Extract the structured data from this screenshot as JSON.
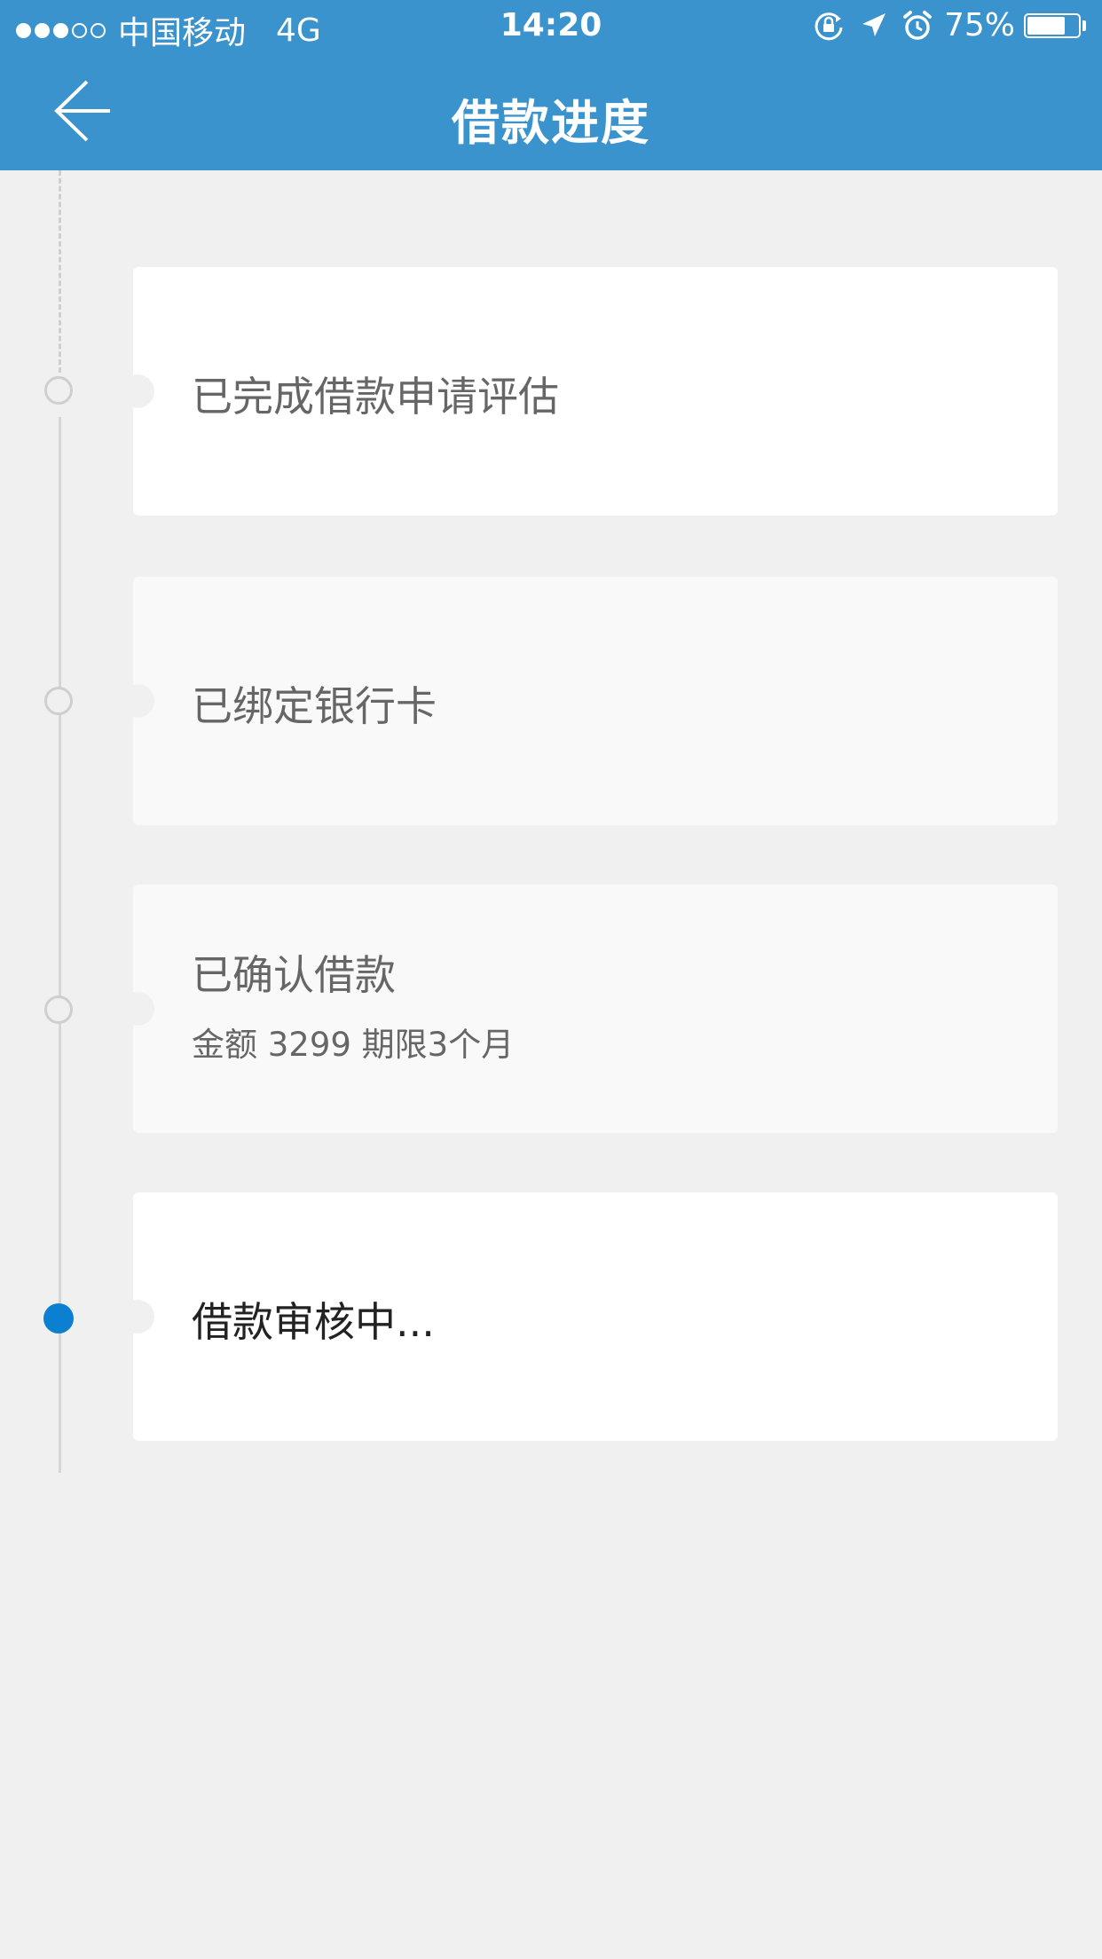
{
  "status_bar": {
    "signal_dots": [
      "on",
      "on",
      "on",
      "off",
      "off"
    ],
    "carrier": "中国移动",
    "network": "4G",
    "time": "14:20",
    "battery_percent": "75%",
    "battery_level": 0.75,
    "icons": [
      "rotation-lock-icon",
      "location-arrow-icon",
      "alarm-icon",
      "battery-icon"
    ]
  },
  "header": {
    "title": "借款进度",
    "back_icon": "arrow-left-icon"
  },
  "colors": {
    "header_bg": "#3a93cc",
    "active_node": "#0b80d0",
    "page_bg": "#f0f0f0"
  },
  "steps": [
    {
      "label": "已完成借款申请评估",
      "state": "done"
    },
    {
      "label": "已绑定银行卡",
      "state": "done"
    },
    {
      "label": "已确认借款",
      "detail": "金额 3299  期限3个月",
      "state": "done"
    },
    {
      "label": "借款审核中...",
      "state": "current"
    }
  ]
}
